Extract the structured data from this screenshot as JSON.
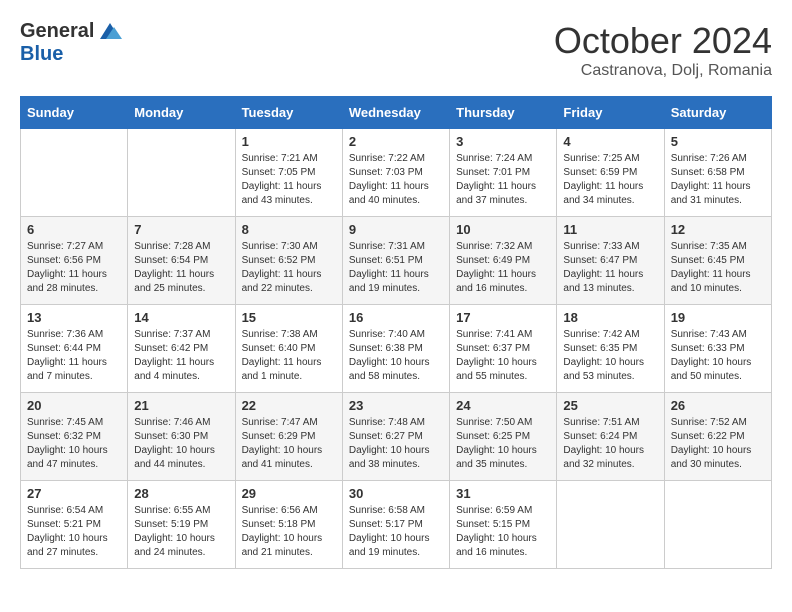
{
  "header": {
    "logo_general": "General",
    "logo_blue": "Blue",
    "month_title": "October 2024",
    "subtitle": "Castranova, Dolj, Romania"
  },
  "days_of_week": [
    "Sunday",
    "Monday",
    "Tuesday",
    "Wednesday",
    "Thursday",
    "Friday",
    "Saturday"
  ],
  "weeks": [
    [
      {
        "day": "",
        "sunrise": "",
        "sunset": "",
        "daylight": ""
      },
      {
        "day": "",
        "sunrise": "",
        "sunset": "",
        "daylight": ""
      },
      {
        "day": "1",
        "sunrise": "Sunrise: 7:21 AM",
        "sunset": "Sunset: 7:05 PM",
        "daylight": "Daylight: 11 hours and 43 minutes."
      },
      {
        "day": "2",
        "sunrise": "Sunrise: 7:22 AM",
        "sunset": "Sunset: 7:03 PM",
        "daylight": "Daylight: 11 hours and 40 minutes."
      },
      {
        "day": "3",
        "sunrise": "Sunrise: 7:24 AM",
        "sunset": "Sunset: 7:01 PM",
        "daylight": "Daylight: 11 hours and 37 minutes."
      },
      {
        "day": "4",
        "sunrise": "Sunrise: 7:25 AM",
        "sunset": "Sunset: 6:59 PM",
        "daylight": "Daylight: 11 hours and 34 minutes."
      },
      {
        "day": "5",
        "sunrise": "Sunrise: 7:26 AM",
        "sunset": "Sunset: 6:58 PM",
        "daylight": "Daylight: 11 hours and 31 minutes."
      }
    ],
    [
      {
        "day": "6",
        "sunrise": "Sunrise: 7:27 AM",
        "sunset": "Sunset: 6:56 PM",
        "daylight": "Daylight: 11 hours and 28 minutes."
      },
      {
        "day": "7",
        "sunrise": "Sunrise: 7:28 AM",
        "sunset": "Sunset: 6:54 PM",
        "daylight": "Daylight: 11 hours and 25 minutes."
      },
      {
        "day": "8",
        "sunrise": "Sunrise: 7:30 AM",
        "sunset": "Sunset: 6:52 PM",
        "daylight": "Daylight: 11 hours and 22 minutes."
      },
      {
        "day": "9",
        "sunrise": "Sunrise: 7:31 AM",
        "sunset": "Sunset: 6:51 PM",
        "daylight": "Daylight: 11 hours and 19 minutes."
      },
      {
        "day": "10",
        "sunrise": "Sunrise: 7:32 AM",
        "sunset": "Sunset: 6:49 PM",
        "daylight": "Daylight: 11 hours and 16 minutes."
      },
      {
        "day": "11",
        "sunrise": "Sunrise: 7:33 AM",
        "sunset": "Sunset: 6:47 PM",
        "daylight": "Daylight: 11 hours and 13 minutes."
      },
      {
        "day": "12",
        "sunrise": "Sunrise: 7:35 AM",
        "sunset": "Sunset: 6:45 PM",
        "daylight": "Daylight: 11 hours and 10 minutes."
      }
    ],
    [
      {
        "day": "13",
        "sunrise": "Sunrise: 7:36 AM",
        "sunset": "Sunset: 6:44 PM",
        "daylight": "Daylight: 11 hours and 7 minutes."
      },
      {
        "day": "14",
        "sunrise": "Sunrise: 7:37 AM",
        "sunset": "Sunset: 6:42 PM",
        "daylight": "Daylight: 11 hours and 4 minutes."
      },
      {
        "day": "15",
        "sunrise": "Sunrise: 7:38 AM",
        "sunset": "Sunset: 6:40 PM",
        "daylight": "Daylight: 11 hours and 1 minute."
      },
      {
        "day": "16",
        "sunrise": "Sunrise: 7:40 AM",
        "sunset": "Sunset: 6:38 PM",
        "daylight": "Daylight: 10 hours and 58 minutes."
      },
      {
        "day": "17",
        "sunrise": "Sunrise: 7:41 AM",
        "sunset": "Sunset: 6:37 PM",
        "daylight": "Daylight: 10 hours and 55 minutes."
      },
      {
        "day": "18",
        "sunrise": "Sunrise: 7:42 AM",
        "sunset": "Sunset: 6:35 PM",
        "daylight": "Daylight: 10 hours and 53 minutes."
      },
      {
        "day": "19",
        "sunrise": "Sunrise: 7:43 AM",
        "sunset": "Sunset: 6:33 PM",
        "daylight": "Daylight: 10 hours and 50 minutes."
      }
    ],
    [
      {
        "day": "20",
        "sunrise": "Sunrise: 7:45 AM",
        "sunset": "Sunset: 6:32 PM",
        "daylight": "Daylight: 10 hours and 47 minutes."
      },
      {
        "day": "21",
        "sunrise": "Sunrise: 7:46 AM",
        "sunset": "Sunset: 6:30 PM",
        "daylight": "Daylight: 10 hours and 44 minutes."
      },
      {
        "day": "22",
        "sunrise": "Sunrise: 7:47 AM",
        "sunset": "Sunset: 6:29 PM",
        "daylight": "Daylight: 10 hours and 41 minutes."
      },
      {
        "day": "23",
        "sunrise": "Sunrise: 7:48 AM",
        "sunset": "Sunset: 6:27 PM",
        "daylight": "Daylight: 10 hours and 38 minutes."
      },
      {
        "day": "24",
        "sunrise": "Sunrise: 7:50 AM",
        "sunset": "Sunset: 6:25 PM",
        "daylight": "Daylight: 10 hours and 35 minutes."
      },
      {
        "day": "25",
        "sunrise": "Sunrise: 7:51 AM",
        "sunset": "Sunset: 6:24 PM",
        "daylight": "Daylight: 10 hours and 32 minutes."
      },
      {
        "day": "26",
        "sunrise": "Sunrise: 7:52 AM",
        "sunset": "Sunset: 6:22 PM",
        "daylight": "Daylight: 10 hours and 30 minutes."
      }
    ],
    [
      {
        "day": "27",
        "sunrise": "Sunrise: 6:54 AM",
        "sunset": "Sunset: 5:21 PM",
        "daylight": "Daylight: 10 hours and 27 minutes."
      },
      {
        "day": "28",
        "sunrise": "Sunrise: 6:55 AM",
        "sunset": "Sunset: 5:19 PM",
        "daylight": "Daylight: 10 hours and 24 minutes."
      },
      {
        "day": "29",
        "sunrise": "Sunrise: 6:56 AM",
        "sunset": "Sunset: 5:18 PM",
        "daylight": "Daylight: 10 hours and 21 minutes."
      },
      {
        "day": "30",
        "sunrise": "Sunrise: 6:58 AM",
        "sunset": "Sunset: 5:17 PM",
        "daylight": "Daylight: 10 hours and 19 minutes."
      },
      {
        "day": "31",
        "sunrise": "Sunrise: 6:59 AM",
        "sunset": "Sunset: 5:15 PM",
        "daylight": "Daylight: 10 hours and 16 minutes."
      },
      {
        "day": "",
        "sunrise": "",
        "sunset": "",
        "daylight": ""
      },
      {
        "day": "",
        "sunrise": "",
        "sunset": "",
        "daylight": ""
      }
    ]
  ]
}
